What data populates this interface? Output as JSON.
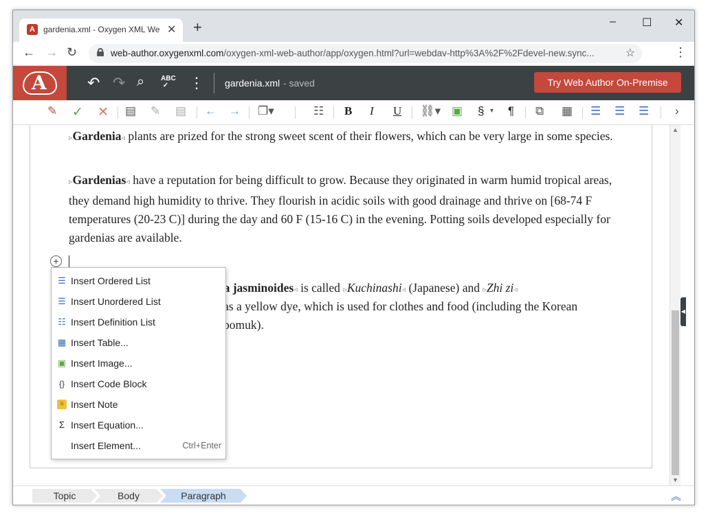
{
  "browser": {
    "tab_title": "gardenia.xml - Oxygen XML Web Author",
    "tab_close": "✕",
    "new_tab": "+",
    "url_host": "web-author.oxygenxml.com",
    "url_path": "/oxygen-xml-web-author/app/oxygen.html?url=webdav-http%3A%2F%2Fdevel-new.sync...",
    "window_controls": [
      "–",
      "☐",
      "✕"
    ]
  },
  "header": {
    "file_name": "gardenia.xml",
    "file_status": " - saved",
    "try_button": "Try Web Author On-Premise",
    "logo_letter": "A",
    "icons": [
      "undo-icon",
      "redo-icon",
      "search-icon",
      "spellcheck-icon",
      "more-icon"
    ]
  },
  "toolbar": {
    "bold": "B",
    "italic": "I",
    "underline": "U",
    "section": "§",
    "pilcrow": "¶",
    "icons": [
      "track-changes-icon",
      "accept-change-icon",
      "reject-change-icon",
      "add-comment-icon",
      "edit-comment-icon",
      "remove-comment-icon",
      "prev-change-icon",
      "next-change-icon",
      "copy-dropdown-icon",
      "outline-icon",
      "link-icon",
      "image-icon",
      "insert-element-icon",
      "conref-icon",
      "insert-list-item-icon",
      "ordered-list-icon",
      "unordered-list-icon",
      "more-tools-icon"
    ]
  },
  "document": {
    "p1_term": "Gardenia",
    "p1_text": " plants are prized for the strong sweet scent of their flowers, which can be very large in some species.",
    "p2_term": "Gardenias",
    "p2_text": " have a reputation for being difficult to grow. Because they originated in warm humid tropical areas, they demand high humidity to thrive. They flourish in acidic soils with good drainage and thrive on [68-74 F temperatures (20-23 C)] during the day and 60 F (15-16 C) in the evening. Potting soils developed especially for gardenias are available.",
    "p3_term": "nia jasminoides",
    "p3_text_a": " is called ",
    "p3_italic_1": "Kuchinashi",
    "p3_text_b": " (Japanese) and ",
    "p3_italic_2": "Zhi zi",
    "p3_line2": "as a yellow dye, which is used for clothes and food (including the Korean",
    "p3_line3": "pomuk)."
  },
  "insert_menu": {
    "items": [
      {
        "label": "Insert Ordered List",
        "icon": "ordered-list-icon"
      },
      {
        "label": "Insert Unordered List",
        "icon": "unordered-list-icon"
      },
      {
        "label": "Insert Definition List",
        "icon": "definition-list-icon"
      },
      {
        "label": "Insert Table...",
        "icon": "table-icon"
      },
      {
        "label": "Insert Image...",
        "icon": "image-icon"
      },
      {
        "label": "Insert Code Block",
        "icon": "code-block-icon"
      },
      {
        "label": "Insert Note",
        "icon": "note-icon"
      },
      {
        "label": "Insert Equation...",
        "icon": "sigma-icon"
      },
      {
        "label": "Insert Element...",
        "icon": "",
        "shortcut": "Ctrl+Enter"
      }
    ]
  },
  "breadcrumb": {
    "items": [
      "Topic",
      "Body",
      "Paragraph"
    ],
    "active": "Paragraph"
  },
  "colors": {
    "brand_red": "#c4483b",
    "header_dark": "#3c4144",
    "accent_blue": "#3b6fb6",
    "breadcrumb_active": "#c9dcf2"
  }
}
